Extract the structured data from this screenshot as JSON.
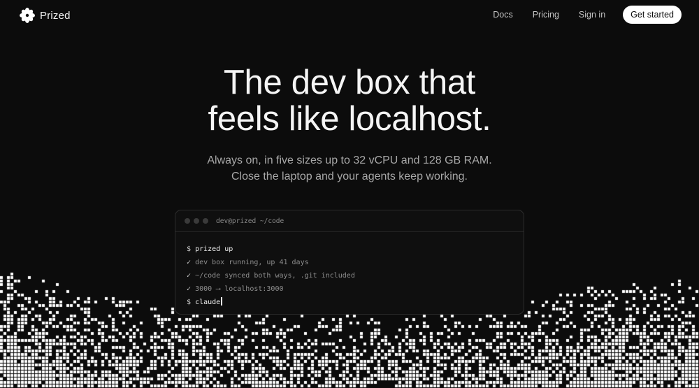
{
  "nav": {
    "brand": "Prized",
    "brand_icon": "asterisk-flower-icon",
    "links": [
      "Docs",
      "Pricing",
      "Sign in"
    ],
    "cta": "Get started"
  },
  "hero": {
    "title_line1": "The dev box that",
    "title_line2": "feels like localhost.",
    "sub_line1": "Always on, in five sizes up to 32 vCPU and 128 GB RAM.",
    "sub_line2": "Close the laptop and your agents keep working."
  },
  "terminal": {
    "title": "dev@prized ~/code",
    "lines": [
      {
        "symbol": "$",
        "text": "prized up",
        "kind": "command"
      },
      {
        "symbol": "✓",
        "text": "dev box running, up 41 days",
        "kind": "output"
      },
      {
        "symbol": "✓",
        "text": "~/code synced both ways, .git included",
        "kind": "output"
      },
      {
        "symbol": "✓",
        "text": "3000 ⟶ localhost:3000",
        "kind": "output"
      },
      {
        "symbol": "$",
        "text": "claude",
        "kind": "command"
      }
    ]
  },
  "colors": {
    "background": "#0c0c0c",
    "foreground": "#ffffff",
    "muted": "#a8a8a8",
    "terminal_bg": "#0f0f0f",
    "terminal_border": "#2c2c2c"
  }
}
